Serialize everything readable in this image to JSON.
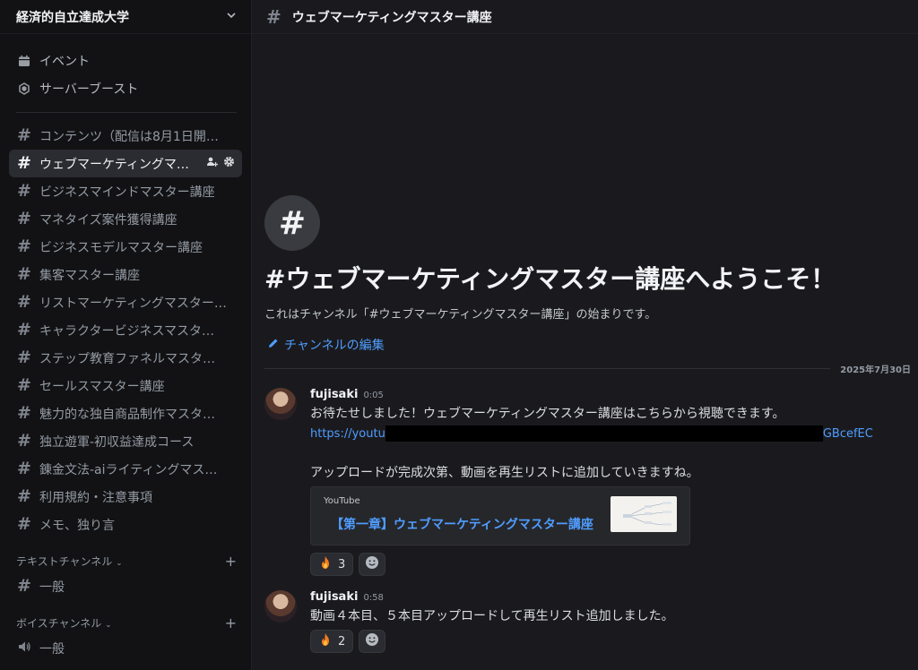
{
  "server": {
    "name": "経済的自立達成大学"
  },
  "nav_top": [
    {
      "label": "イベント",
      "icon": "calendar-icon"
    },
    {
      "label": "サーバーブースト",
      "icon": "boost-icon"
    }
  ],
  "channels": [
    {
      "label": "コンテンツ（配信は8月1日開…",
      "active": false
    },
    {
      "label": "ウェブマーケティングマ…",
      "active": true
    },
    {
      "label": "ビジネスマインドマスター講座",
      "active": false
    },
    {
      "label": "マネタイズ案件獲得講座",
      "active": false
    },
    {
      "label": "ビジネスモデルマスター講座",
      "active": false
    },
    {
      "label": "集客マスター講座",
      "active": false
    },
    {
      "label": "リストマーケティングマスター…",
      "active": false
    },
    {
      "label": "キャラクタービジネスマスタ…",
      "active": false
    },
    {
      "label": "ステップ教育ファネルマスタ…",
      "active": false
    },
    {
      "label": "セールスマスター講座",
      "active": false
    },
    {
      "label": "魅力的な独自商品制作マスタ…",
      "active": false
    },
    {
      "label": "独立遊軍-初収益達成コース",
      "active": false
    },
    {
      "label": "錬金文法-aiライティングマス…",
      "active": false
    },
    {
      "label": "利用規約・注意事項",
      "active": false
    },
    {
      "label": "メモ、独り言",
      "active": false
    }
  ],
  "categories": {
    "text": {
      "label": "テキストチャンネル",
      "channel": "一般"
    },
    "voice": {
      "label": "ボイスチャンネル",
      "channel": "一般"
    }
  },
  "header": {
    "title": "ウェブマーケティングマスター講座"
  },
  "welcome": {
    "title": "#ウェブマーケティングマスター講座へようこそ！",
    "subtitle": "これはチャンネル「#ウェブマーケティングマスター講座」の始まりです。",
    "edit_label": "チャンネルの編集"
  },
  "date_separator": "2025年7月30日",
  "messages": [
    {
      "author": "fujisaki",
      "time": "0:05",
      "line1": "お待たせしました！ウェブマーケティングマスター講座はこちらから視聴できます。",
      "link_start": "https://youtu",
      "link_end": "GBcefEC",
      "line2": "アップロードが完成次第、動画を再生リストに追加していきますね。",
      "embed_provider": "YouTube",
      "embed_title": "【第一章】ウェブマーケティングマスター講座",
      "reaction_count": "3"
    },
    {
      "author": "fujisaki",
      "time": "0:58",
      "line1": "動画４本目、５本目アップロードして再生リスト追加しました。",
      "reaction_count": "2"
    }
  ],
  "colors": {
    "accent": "#4f9dff",
    "background": "#1a1a1e",
    "sidebar": "#121214"
  }
}
